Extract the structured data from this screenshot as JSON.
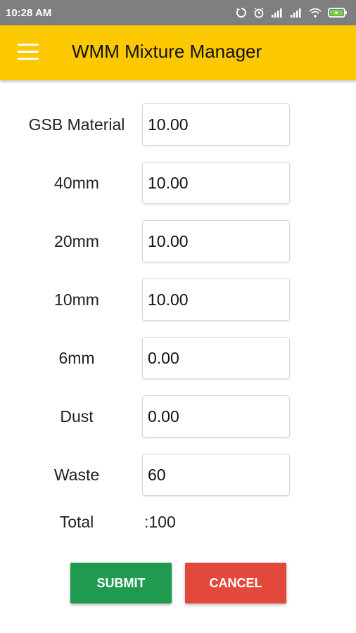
{
  "status_bar": {
    "time": "10:28 AM",
    "icons": [
      "sync-icon",
      "alarm-icon",
      "signal-icon",
      "signal-icon",
      "wifi-icon",
      "battery-charging-icon"
    ]
  },
  "app_bar": {
    "title": "WMM Mixture Manager",
    "background_color": "#fcc800"
  },
  "form": {
    "fields": [
      {
        "label": "GSB Material",
        "value": "10.00"
      },
      {
        "label": "40mm",
        "value": "10.00"
      },
      {
        "label": "20mm",
        "value": "10.00"
      },
      {
        "label": "10mm",
        "value": "10.00"
      },
      {
        "label": "6mm",
        "value": "0.00"
      },
      {
        "label": "Dust",
        "value": "0.00"
      },
      {
        "label": "Waste",
        "value": "60"
      }
    ],
    "total_label": "Total",
    "total_value": ":100"
  },
  "buttons": {
    "submit_label": "SUBMIT",
    "cancel_label": "CANCEL",
    "submit_color": "#1f9a4f",
    "cancel_color": "#e2483c"
  }
}
